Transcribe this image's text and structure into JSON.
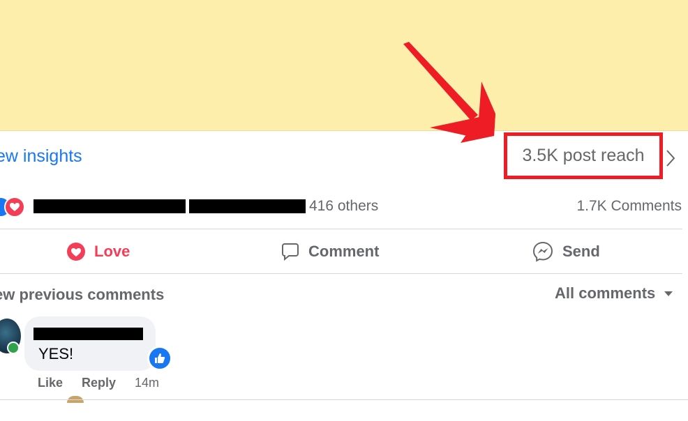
{
  "post": {
    "insights_link": "ew insights",
    "reach": "3.5K post reach"
  },
  "reactions": {
    "tail_text": "416 others",
    "comments_count": "1.7K Comments"
  },
  "actions": {
    "love": "Love",
    "comment": "Comment",
    "send": "Send"
  },
  "comments": {
    "view_previous": "ew previous comments",
    "filter": "All comments",
    "items": [
      {
        "text": "YES!",
        "like": "Like",
        "reply": "Reply",
        "time": "14m"
      }
    ]
  },
  "colors": {
    "accent_blue": "#1877f2",
    "love_red": "#f33e58",
    "annotation_red": "#ee1c24",
    "post_background": "#fdeeab"
  },
  "icons": [
    "like-reaction-icon",
    "love-reaction-icon",
    "love-icon",
    "comment-icon",
    "messenger-send-icon",
    "chevron-right-icon",
    "caret-down-icon",
    "thumbs-up-icon",
    "annotation-arrow"
  ]
}
